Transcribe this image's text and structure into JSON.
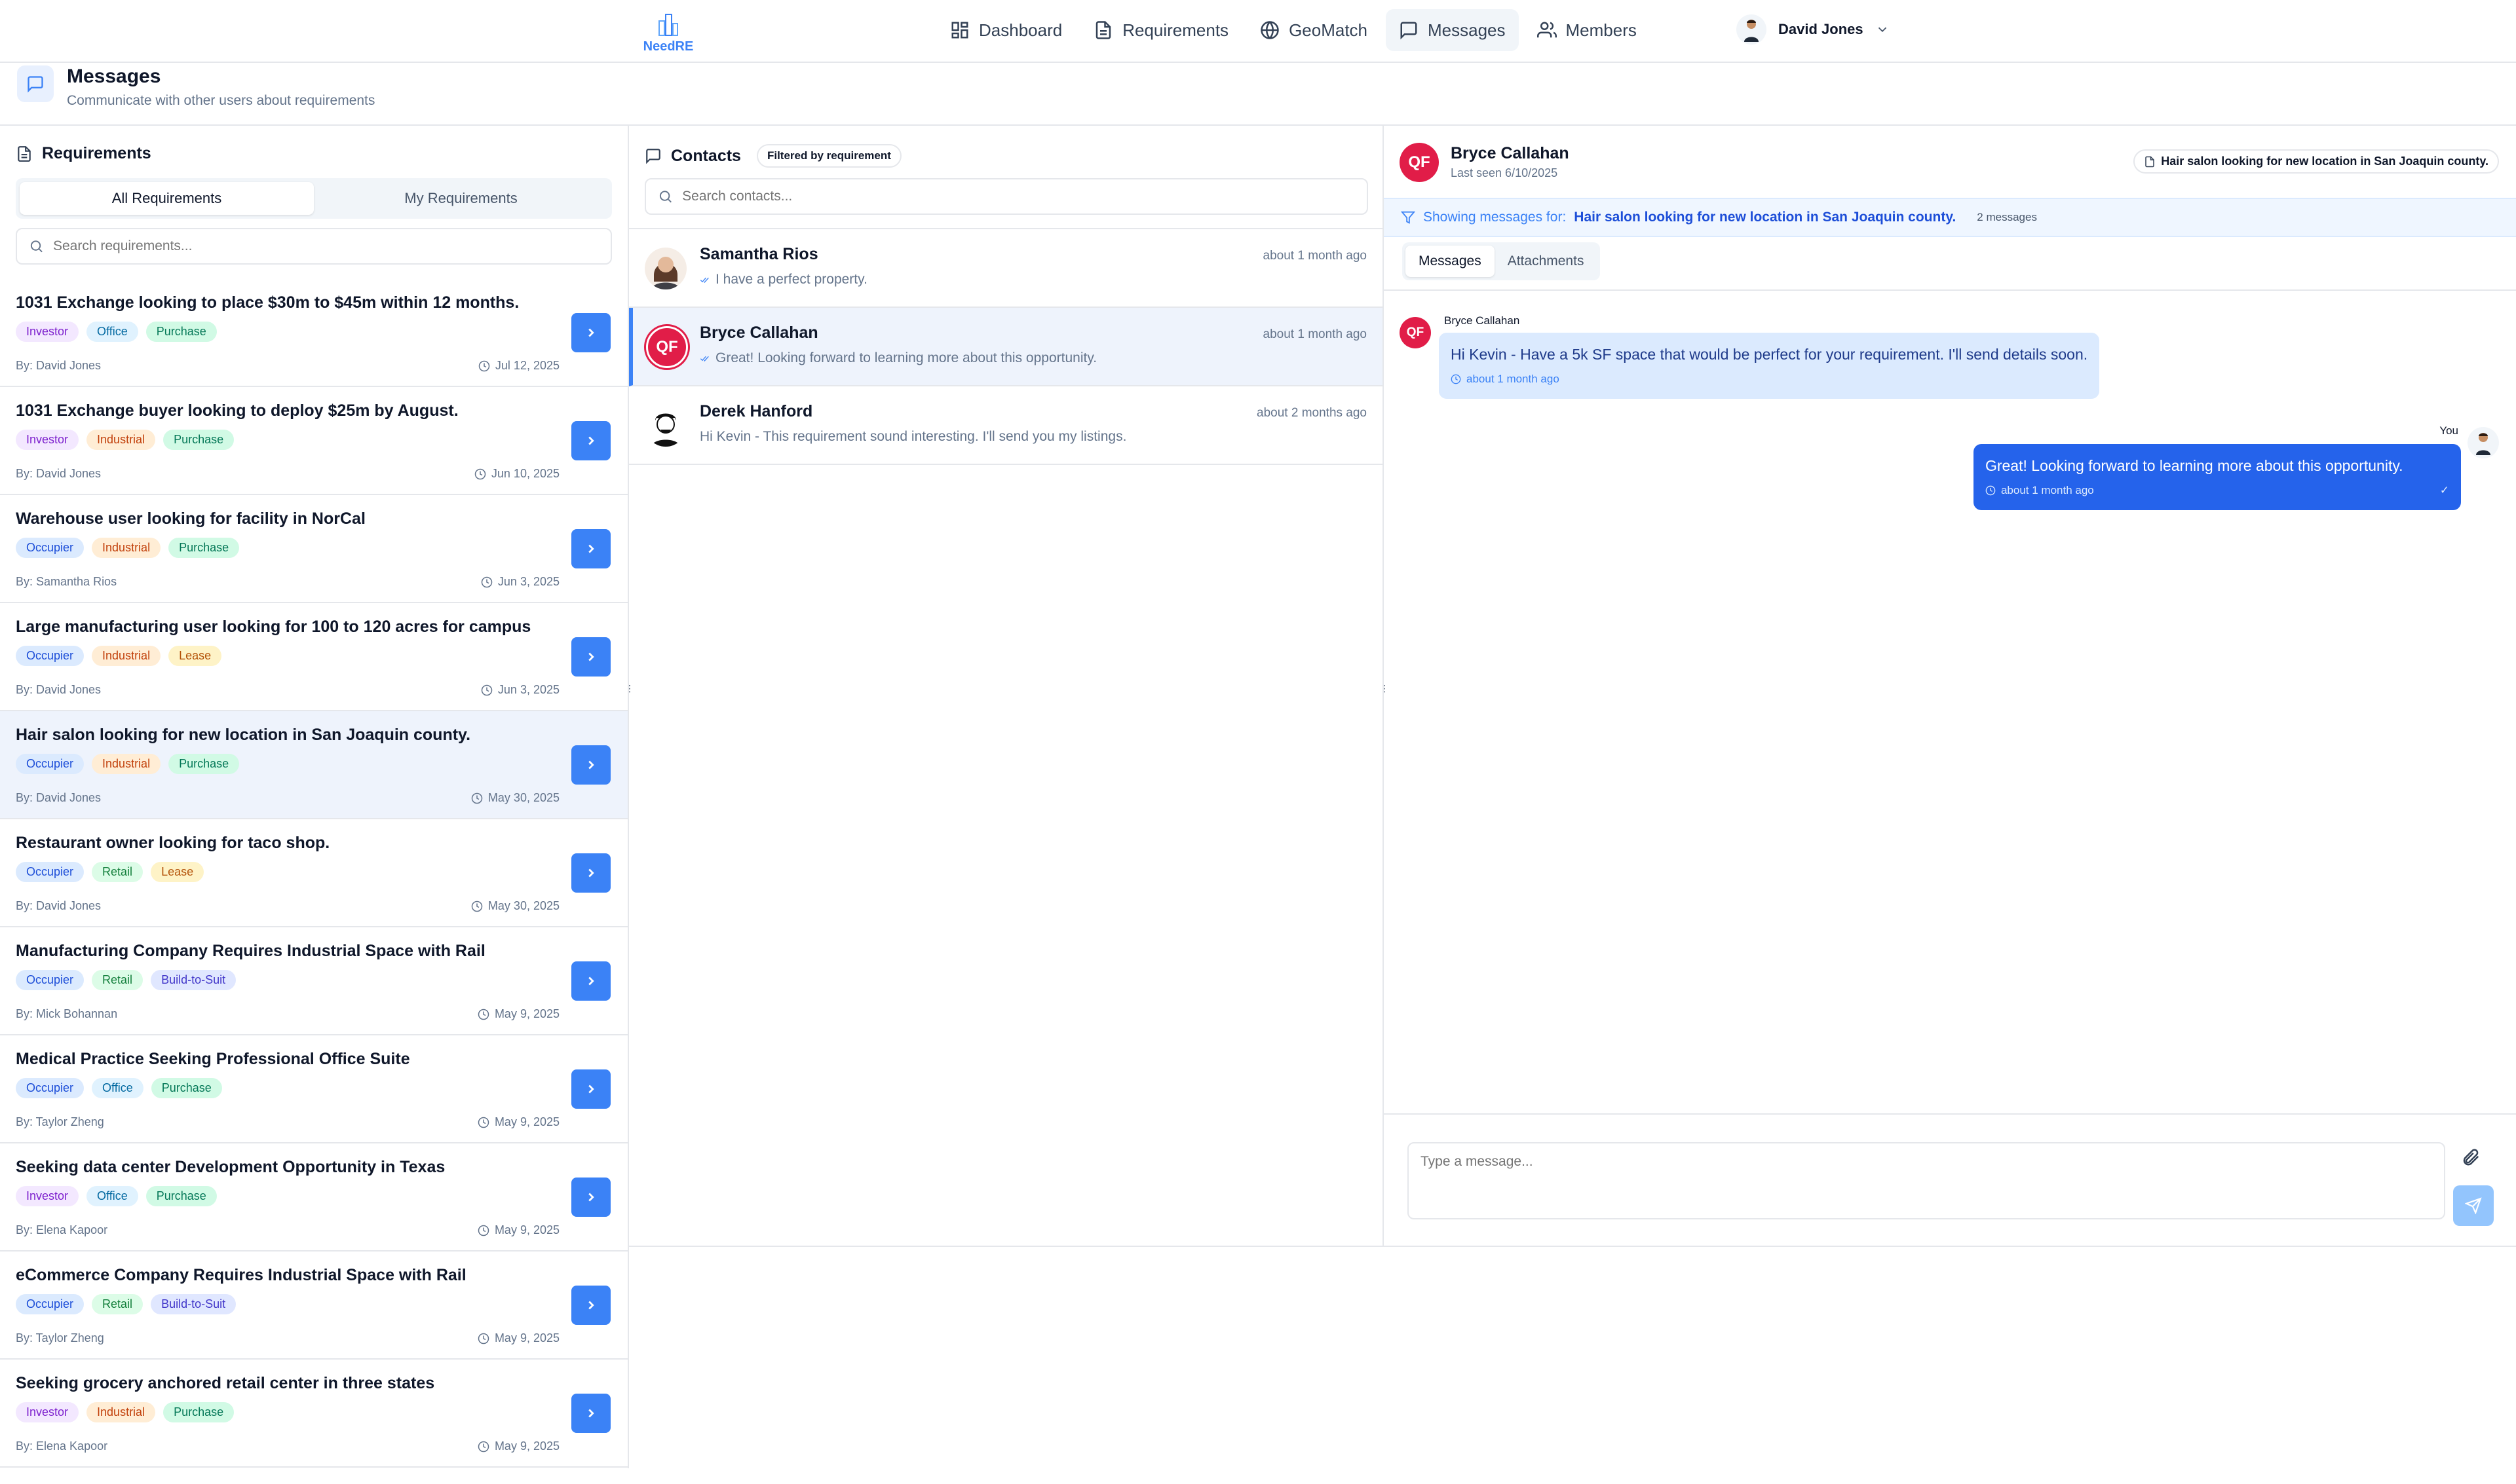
{
  "app": {
    "logo_text": "NeedRE"
  },
  "nav": [
    {
      "label": "Dashboard",
      "icon": "dashboard-icon"
    },
    {
      "label": "Requirements",
      "icon": "document-icon"
    },
    {
      "label": "GeoMatch",
      "icon": "globe-icon"
    },
    {
      "label": "Messages",
      "icon": "message-icon",
      "active": true
    },
    {
      "label": "Members",
      "icon": "users-icon"
    }
  ],
  "user": {
    "name": "David Jones"
  },
  "page": {
    "title": "Messages",
    "subtitle": "Communicate with other users about requirements"
  },
  "requirements_panel": {
    "title": "Requirements",
    "tabs": [
      "All Requirements",
      "My Requirements"
    ],
    "active_tab": "All Requirements",
    "search_placeholder": "Search requirements...",
    "items": [
      {
        "title": "1031 Exchange looking to place $30m to $45m within 12 months.",
        "tags": [
          "Investor",
          "Office",
          "Purchase"
        ],
        "by": "By: David Jones",
        "date": "Jul 12, 2025"
      },
      {
        "title": "1031 Exchange buyer looking to deploy $25m by August.",
        "tags": [
          "Investor",
          "Industrial",
          "Purchase"
        ],
        "by": "By: David Jones",
        "date": "Jun 10, 2025"
      },
      {
        "title": "Warehouse user looking for facility in NorCal",
        "tags": [
          "Occupier",
          "Industrial",
          "Purchase"
        ],
        "by": "By: Samantha Rios",
        "date": "Jun 3, 2025"
      },
      {
        "title": "Large manufacturing user looking for 100 to 120 acres for campus",
        "tags": [
          "Occupier",
          "Industrial",
          "Lease"
        ],
        "by": "By: David Jones",
        "date": "Jun 3, 2025"
      },
      {
        "title": "Hair salon looking for new location in San Joaquin county.",
        "tags": [
          "Occupier",
          "Industrial",
          "Purchase"
        ],
        "by": "By: David Jones",
        "date": "May 30, 2025",
        "selected": true
      },
      {
        "title": "Restaurant owner looking for taco shop.",
        "tags": [
          "Occupier",
          "Retail",
          "Lease"
        ],
        "by": "By: David Jones",
        "date": "May 30, 2025"
      },
      {
        "title": "Manufacturing Company Requires Industrial Space with Rail",
        "tags": [
          "Occupier",
          "Retail",
          "Build-to-Suit"
        ],
        "by": "By: Mick Bohannan",
        "date": "May 9, 2025"
      },
      {
        "title": "Medical Practice Seeking Professional Office Suite",
        "tags": [
          "Occupier",
          "Office",
          "Purchase"
        ],
        "by": "By: Taylor Zheng",
        "date": "May 9, 2025"
      },
      {
        "title": "Seeking data center Development Opportunity in Texas",
        "tags": [
          "Investor",
          "Office",
          "Purchase"
        ],
        "by": "By: Elena Kapoor",
        "date": "May 9, 2025"
      },
      {
        "title": "eCommerce Company Requires Industrial Space with Rail",
        "tags": [
          "Occupier",
          "Retail",
          "Build-to-Suit"
        ],
        "by": "By: Taylor Zheng",
        "date": "May 9, 2025"
      },
      {
        "title": "Seeking grocery anchored retail center in three states",
        "tags": [
          "Investor",
          "Industrial",
          "Purchase"
        ],
        "by": "By: Elena Kapoor",
        "date": "May 9, 2025"
      }
    ]
  },
  "contacts_panel": {
    "title": "Contacts",
    "badge": "Filtered by requirement",
    "search_placeholder": "Search contacts...",
    "items": [
      {
        "name": "Samantha Rios",
        "preview": "I have a perfect property.",
        "time": "about 1 month ago",
        "avatar": "photo"
      },
      {
        "name": "Bryce Callahan",
        "preview": "Great! Looking forward to learning more about this opportunity.",
        "time": "about 1 month ago",
        "avatar": "QF",
        "selected": true
      },
      {
        "name": "Derek Hanford",
        "preview": "Hi Kevin - This requirement sound interesting. I'll send you my listings.",
        "time": "about 2 months ago",
        "avatar": "illustration"
      }
    ]
  },
  "chat": {
    "contact_name": "Bryce Callahan",
    "avatar_initials": "QF",
    "last_seen": "Last seen 6/10/2025",
    "requirement_badge": "Hair salon looking for new location in San Joaquin county.",
    "filter_prefix": "Showing messages for:",
    "filter_req": "Hair salon looking for new location in San Joaquin county.",
    "message_count": "2 messages",
    "tabs": [
      "Messages",
      "Attachments"
    ],
    "messages": [
      {
        "sender": "Bryce Callahan",
        "text": "Hi Kevin - Have a 5k SF space that would be perfect for your requirement.  I'll send details soon.",
        "time": "about 1 month ago",
        "incoming": true
      },
      {
        "sender": "You",
        "text": "Great!  Looking forward to learning more about this opportunity.",
        "time": "about 1 month ago",
        "incoming": false
      }
    ],
    "composer_placeholder": "Type a message..."
  },
  "colors": {
    "primary": "#3b82f6",
    "accent_red": "#e11d48",
    "selected_bg": "#eef3fc"
  }
}
